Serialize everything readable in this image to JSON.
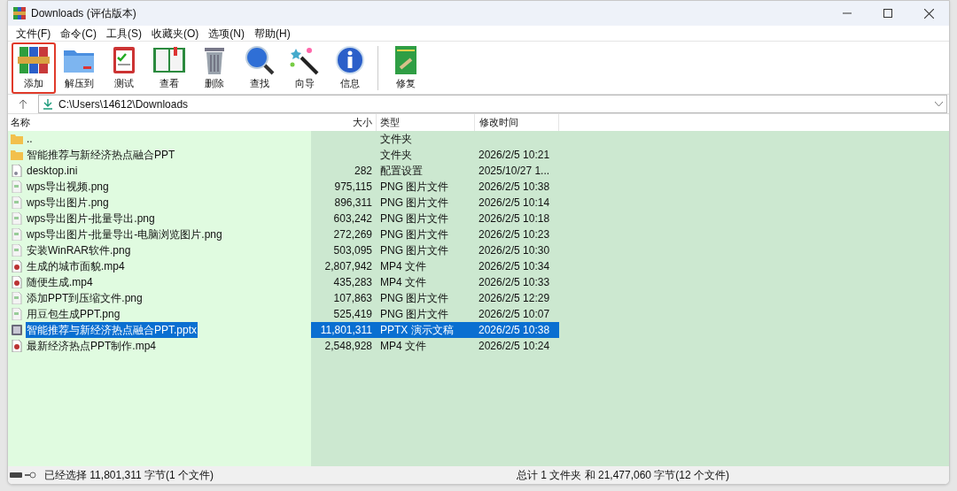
{
  "window": {
    "title": "Downloads (评估版本)"
  },
  "menu": [
    "文件(F)",
    "命令(C)",
    "工具(S)",
    "收藏夹(O)",
    "选项(N)",
    "帮助(H)"
  ],
  "toolbar": [
    {
      "kind": "add",
      "label": "添加",
      "selected": true
    },
    {
      "kind": "extract",
      "label": "解压到",
      "selected": false
    },
    {
      "kind": "test",
      "label": "测试",
      "selected": false
    },
    {
      "kind": "view",
      "label": "查看",
      "selected": false
    },
    {
      "kind": "delete",
      "label": "删除",
      "selected": false
    },
    {
      "kind": "find",
      "label": "查找",
      "selected": false
    },
    {
      "kind": "wizard",
      "label": "向导",
      "selected": false
    },
    {
      "kind": "info",
      "label": "信息",
      "selected": false
    },
    {
      "kind": "repair",
      "label": "修复",
      "selected": false
    }
  ],
  "address": {
    "value": "C:\\Users\\14612\\Downloads"
  },
  "table": {
    "columns": [
      "名称",
      "大小",
      "类型",
      "修改时间"
    ],
    "rows": [
      {
        "kind": "folder",
        "name": "..",
        "size": "",
        "type": "文件夹",
        "modified": "",
        "selected": false
      },
      {
        "kind": "folder",
        "name": "智能推荐与新经济热点融合PPT",
        "size": "",
        "type": "文件夹",
        "modified": "2026/2/5 10:21",
        "selected": false
      },
      {
        "kind": "ini",
        "name": "desktop.ini",
        "size": "282",
        "type": "配置设置",
        "modified": "2025/10/27 1...",
        "selected": false
      },
      {
        "kind": "image",
        "name": "wps导出视频.png",
        "size": "975,115",
        "type": "PNG 图片文件",
        "modified": "2026/2/5 10:38",
        "selected": false
      },
      {
        "kind": "image",
        "name": "wps导出图片.png",
        "size": "896,311",
        "type": "PNG 图片文件",
        "modified": "2026/2/5 10:14",
        "selected": false
      },
      {
        "kind": "image",
        "name": "wps导出图片-批量导出.png",
        "size": "603,242",
        "type": "PNG 图片文件",
        "modified": "2026/2/5 10:18",
        "selected": false
      },
      {
        "kind": "image",
        "name": "wps导出图片-批量导出-电脑浏览图片.png",
        "size": "272,269",
        "type": "PNG 图片文件",
        "modified": "2026/2/5 10:23",
        "selected": false
      },
      {
        "kind": "image",
        "name": "安装WinRAR软件.png",
        "size": "503,095",
        "type": "PNG 图片文件",
        "modified": "2026/2/5 10:30",
        "selected": false
      },
      {
        "kind": "video",
        "name": "生成的城市面貌.mp4",
        "size": "2,807,942",
        "type": "MP4 文件",
        "modified": "2026/2/5 10:34",
        "selected": false
      },
      {
        "kind": "video",
        "name": "随便生成.mp4",
        "size": "435,283",
        "type": "MP4 文件",
        "modified": "2026/2/5 10:33",
        "selected": false
      },
      {
        "kind": "image",
        "name": "添加PPT到压缩文件.png",
        "size": "107,863",
        "type": "PNG 图片文件",
        "modified": "2026/2/5 12:29",
        "selected": false
      },
      {
        "kind": "image",
        "name": "用豆包生成PPT.png",
        "size": "525,419",
        "type": "PNG 图片文件",
        "modified": "2026/2/5 10:07",
        "selected": false
      },
      {
        "kind": "slides",
        "name": "智能推荐与新经济热点融合PPT.pptx",
        "size": "11,801,311",
        "type": "PPTX 演示文稿",
        "modified": "2026/2/5 10:38",
        "selected": true
      },
      {
        "kind": "video",
        "name": "最新经济热点PPT制作.mp4",
        "size": "2,548,928",
        "type": "MP4 文件",
        "modified": "2026/2/5 10:24",
        "selected": false
      }
    ]
  },
  "status_bar": {
    "left": "已经选择 11,801,311 字节(1 个文件)",
    "right": "总计 1 文件夹 和 21,477,060 字节(12 个文件)"
  }
}
